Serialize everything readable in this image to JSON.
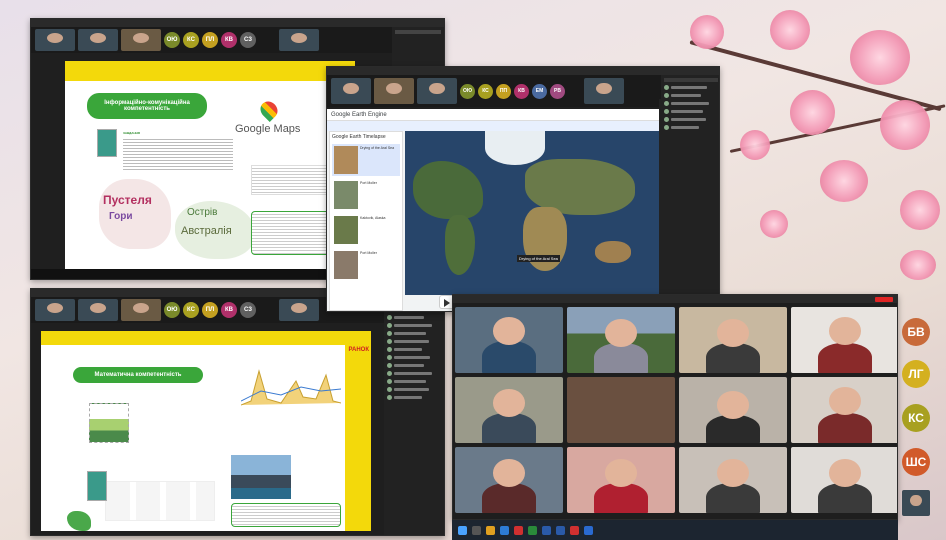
{
  "slide_top_left": {
    "heading": "Інформаційно-комунікаційна компетентність",
    "task_label": "ЗАВДАННЯ",
    "logo_text": "Google Maps",
    "word_cloud": [
      "Пустеля",
      "Острів",
      "Австралія",
      "Гори"
    ]
  },
  "slide_bottom_left": {
    "heading": "Математична компетентність",
    "brand": "РАНОК"
  },
  "earth_window": {
    "app_title": "Google Earth Engine",
    "panel_title": "Google Earth Timelapse",
    "card1": "Drying of the Aral Sea",
    "card2": "Port Moller",
    "card3": "Kaktovik, Alaska",
    "card4": "Port Moller",
    "tooltip": "Drying of the Aral Sea"
  },
  "gallery": {
    "avatars": [
      "БВ",
      "ЛГ",
      "КС",
      "ШС"
    ],
    "avatar_colors": [
      "#c86a3a",
      "#d4b020",
      "#a8a020",
      "#d15a2a"
    ]
  },
  "strip_top_left": {
    "avatars": [
      "ОЮ",
      "КС",
      "ПЛ",
      "КВ",
      "СЗ"
    ]
  },
  "strip_earth": {
    "avatars": [
      "ОЮ",
      "КС",
      "ПП",
      "КВ",
      "ЕМ",
      "РВ"
    ]
  },
  "strip_bottom_left": {
    "avatars": [
      "ОЮ",
      "КС",
      "ПЛ",
      "КВ",
      "СЗ"
    ]
  }
}
